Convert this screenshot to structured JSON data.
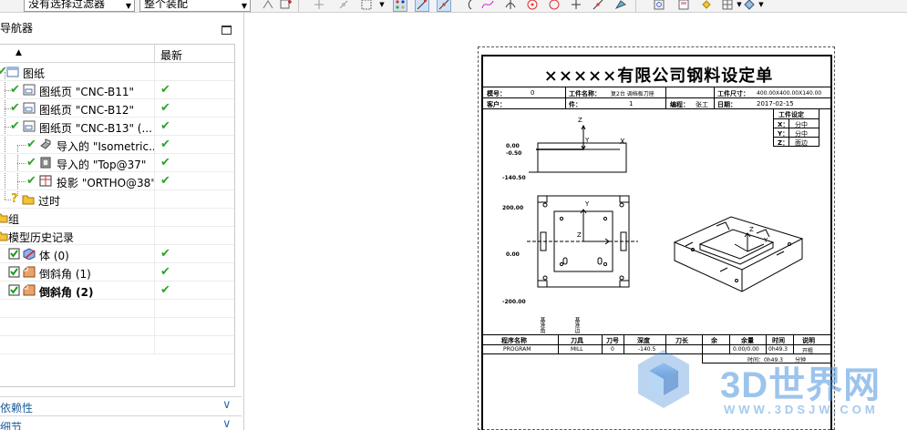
{
  "toolbar": {
    "filter_select": "没有选择过滤器",
    "assembly_select": "整个装配"
  },
  "navigator": {
    "title": "导航器",
    "col_latest": "最新",
    "rows": [
      {
        "label": "图纸",
        "latest": ""
      },
      {
        "label": "图纸页 \"CNC-B11\"",
        "latest": "✔"
      },
      {
        "label": "图纸页 \"CNC-B12\"",
        "latest": "✔"
      },
      {
        "label": "图纸页 \"CNC-B13\" (...",
        "latest": "✔"
      },
      {
        "label": "导入的 \"Isometric...",
        "latest": "✔"
      },
      {
        "label": "导入的 \"Top@37\"",
        "latest": "✔"
      },
      {
        "label": "投影 \"ORTHO@38\"",
        "latest": "✔"
      },
      {
        "label": "过时",
        "latest": ""
      },
      {
        "label": "组",
        "latest": ""
      },
      {
        "label": "模型历史记录",
        "latest": ""
      },
      {
        "label": "体 (0)",
        "latest": "✔"
      },
      {
        "label": "倒斜角 (1)",
        "latest": "✔"
      },
      {
        "label": "倒斜角 (2)",
        "latest": "✔"
      }
    ],
    "panels": [
      {
        "label": "依赖性"
      },
      {
        "label": "细节"
      }
    ]
  },
  "drawing": {
    "title": "×××××有限公司钢料设定单",
    "header_row1": {
      "part_no_label": "模号：",
      "part_no": "0",
      "workpiece_name_label": "工件名称：",
      "workpiece_name": "复2台 调档板刀座",
      "workpiece_size_label": "工件尺寸：",
      "workpiece_size": "400.00X400.00X140.00"
    },
    "header_row2": {
      "customer_label": "客户：",
      "qty_label": "件：",
      "qty": "1",
      "programmer_label": "编程：",
      "programmer": "张工",
      "date_label": "日期：",
      "date": "2017-02-15"
    },
    "coord_setting": {
      "title": "工件设定",
      "x": "分中",
      "y": "分中",
      "z": "面边"
    },
    "dims": {
      "z_top": "0.00",
      "z_mid": "-0.50",
      "z_bot": "-140.50",
      "y_top": "200.00",
      "y_mid": "0.00",
      "y_bot": "-200.00"
    },
    "program_table": {
      "headers": [
        "程序名称",
        "刀具",
        "刀号",
        "深度",
        "刀长",
        "余",
        "余量",
        "时间",
        "说明"
      ],
      "row": {
        "name": "PROGRAM",
        "tool": "MILL",
        "tool_no": "0",
        "depth": "-140.5",
        "stock": "0.00/0.00",
        "time": "0h49.3",
        "note": "开粗"
      },
      "footer_time": "时间：0h49.3",
      "footer_note": "分钟"
    },
    "vertical_labels": [
      "基准角",
      "基准边"
    ]
  },
  "watermark": {
    "brand": "3D世界网",
    "url": "WWW.3DSJW.COM"
  }
}
